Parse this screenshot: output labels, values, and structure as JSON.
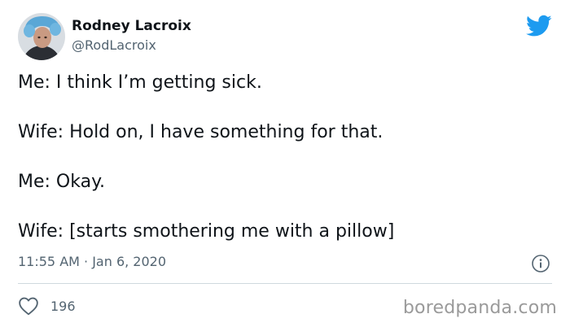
{
  "author": {
    "display_name": "Rodney Lacroix",
    "handle": "@RodLacroix"
  },
  "tweet": {
    "lines": [
      "Me: I think I’m getting sick.",
      "Wife: Hold on, I have something for that.",
      "Me: Okay.",
      "Wife: [starts smothering me with a pillow]"
    ],
    "timestamp": "11:55 AM · Jan 6, 2020"
  },
  "engagement": {
    "likes": "196"
  },
  "icons": {
    "brand": "twitter-bird-icon",
    "info": "info-icon",
    "like": "heart-icon"
  },
  "colors": {
    "twitter_blue": "#1d9bf0",
    "text_primary": "#0f1419",
    "text_secondary": "#536471",
    "divider": "#cfd9de",
    "watermark": "#9a9a9a"
  },
  "watermark": "boredpanda.com"
}
